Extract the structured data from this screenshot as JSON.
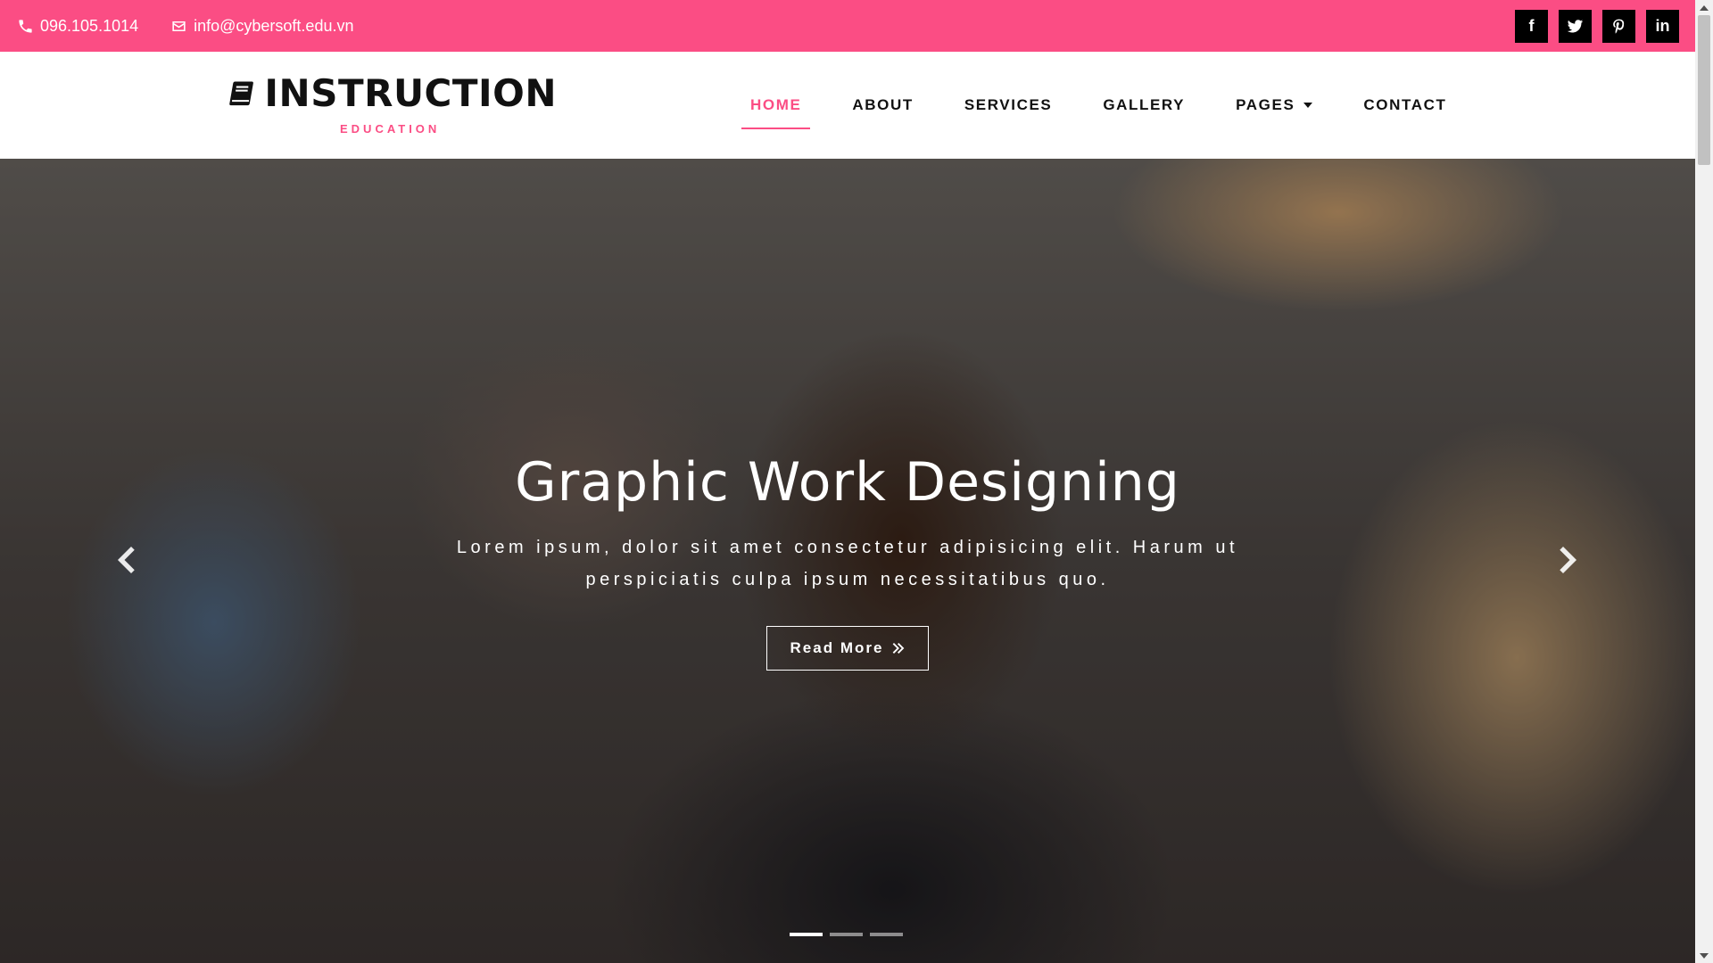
{
  "topbar": {
    "phone": "096.105.1014",
    "email": "info@cybersoft.edu.vn",
    "social": [
      {
        "icon": "facebook-icon",
        "label": "f"
      },
      {
        "icon": "twitter-icon",
        "label": ""
      },
      {
        "icon": "pinterest-icon",
        "label": ""
      },
      {
        "icon": "linkedin-icon",
        "label": "in"
      }
    ],
    "bg_color": "#fb4d84"
  },
  "brand": {
    "title": "INSTRUCTION",
    "subtitle": "EDUCATION",
    "icon": "book-icon"
  },
  "nav": {
    "items": [
      {
        "label": "HOME",
        "active": true
      },
      {
        "label": "ABOUT",
        "active": false
      },
      {
        "label": "SERVICES",
        "active": false
      },
      {
        "label": "GALLERY",
        "active": false
      },
      {
        "label": "PAGES",
        "active": false,
        "dropdown": true
      },
      {
        "label": "CONTACT",
        "active": false
      }
    ],
    "accent_color": "#fb4d84"
  },
  "hero": {
    "title": "Graphic Work Designing",
    "text": "Lorem ipsum, dolor sit amet consectetur adipisicing elit. Harum ut perspiciatis culpa ipsum necessitatibus quo.",
    "button_label": "Read More",
    "slides_count": 3,
    "active_slide": 1
  }
}
